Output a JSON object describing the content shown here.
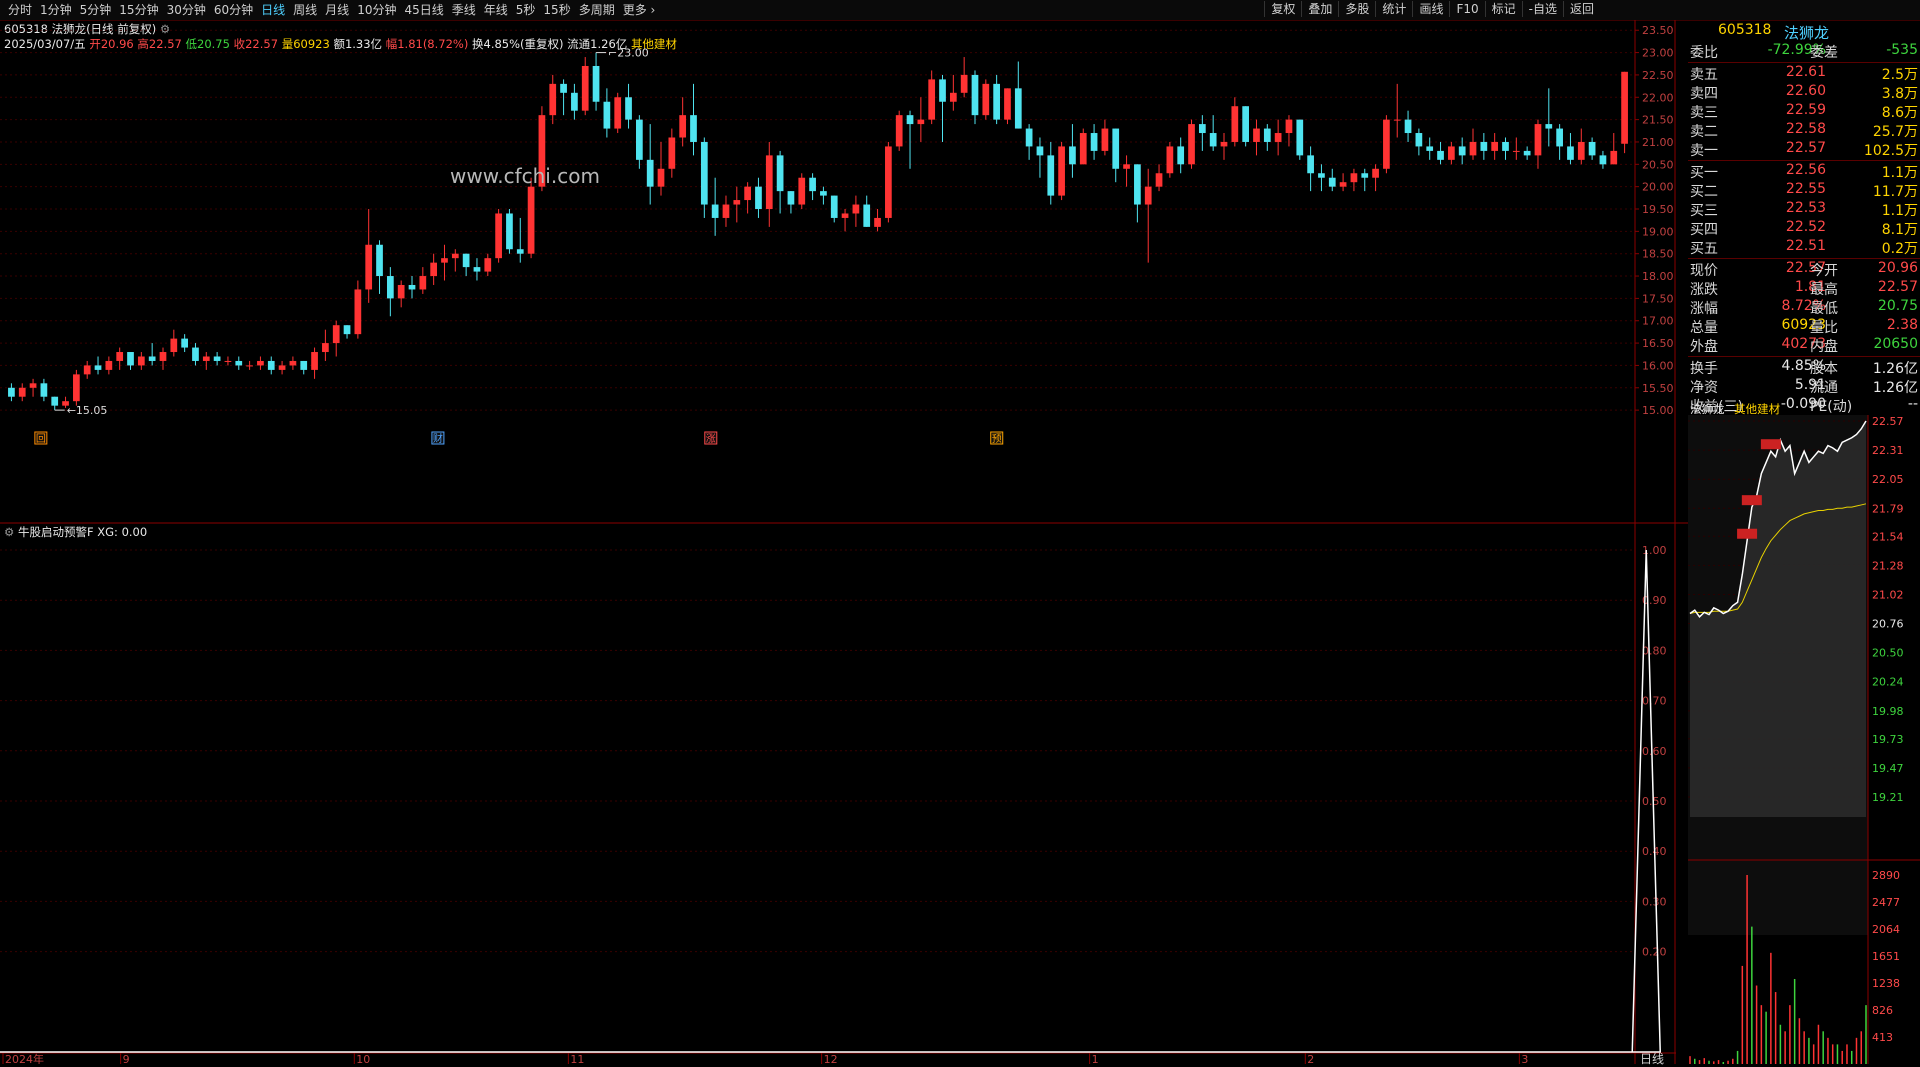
{
  "toolbar": {
    "tabs": [
      "分时",
      "1分钟",
      "5分钟",
      "15分钟",
      "30分钟",
      "60分钟",
      "日线",
      "周线",
      "月线",
      "10分钟",
      "45日线",
      "季线",
      "年线",
      "5秒",
      "15秒",
      "多周期",
      "更多"
    ],
    "active_tab": "日线",
    "tools": [
      "复权",
      "叠加",
      "多股",
      "统计",
      "画线",
      "F10",
      "标记",
      "-自选",
      "返回"
    ]
  },
  "stock": {
    "code": "605318",
    "name": "法狮龙",
    "period_desc": "(日线 前复权)",
    "date": "2025/03/07/五",
    "open_label": "开",
    "open": "20.96",
    "high_label": "高",
    "high": "22.57",
    "low_label": "低",
    "low": "20.75",
    "close_label": "收",
    "close": "22.57",
    "vol_label": "量",
    "vol": "60923",
    "amt_label": "额",
    "amt": "1.33亿",
    "chg_label": "幅",
    "chg": "1.81(8.72%)",
    "turn": "换4.85%(重复权)",
    "float": "流通1.26亿",
    "industry": "其他建材"
  },
  "watermark": "www.cfchi.com",
  "indicator": {
    "title": "牛股启动预警F",
    "value": "XG: 0.00"
  },
  "colors": {
    "up": "#ff3333",
    "down": "#4fe4f0",
    "axis": "#8b0000",
    "grid": "#3a0000",
    "indicator_line": "#ffffff"
  },
  "chart_data": [
    {
      "type": "candlestick",
      "title": "605318 法狮龙 日线",
      "ylim": [
        14.6,
        23.55
      ],
      "yticks": [
        "23.50",
        "23.00",
        "22.50",
        "22.00",
        "21.50",
        "21.00",
        "20.50",
        "20.00",
        "19.50",
        "19.00",
        "18.50",
        "18.00",
        "17.50",
        "17.00",
        "16.50",
        "16.00",
        "15.50",
        "15.00"
      ],
      "x_month_labels": [
        "2024年",
        "9",
        "10",
        "11",
        "12",
        "1",
        "2",
        "3"
      ],
      "annotations": {
        "max": "23.00",
        "min": "15.05",
        "markers": [
          "回",
          "财",
          "涨",
          "预"
        ]
      },
      "candles": [
        [
          15.5,
          15.6,
          15.2,
          15.3
        ],
        [
          15.3,
          15.6,
          15.2,
          15.5
        ],
        [
          15.5,
          15.7,
          15.3,
          15.6
        ],
        [
          15.6,
          15.7,
          15.2,
          15.3
        ],
        [
          15.3,
          15.3,
          15.0,
          15.1
        ],
        [
          15.1,
          15.3,
          15.05,
          15.2
        ],
        [
          15.2,
          15.9,
          15.1,
          15.8
        ],
        [
          15.8,
          16.1,
          15.7,
          16.0
        ],
        [
          16.0,
          16.2,
          15.8,
          15.9
        ],
        [
          15.9,
          16.2,
          15.8,
          16.1
        ],
        [
          16.1,
          16.4,
          15.9,
          16.3
        ],
        [
          16.3,
          16.2,
          15.9,
          16.0
        ],
        [
          16.0,
          16.3,
          15.9,
          16.2
        ],
        [
          16.2,
          16.5,
          16.0,
          16.1
        ],
        [
          16.1,
          16.4,
          15.9,
          16.3
        ],
        [
          16.3,
          16.8,
          16.2,
          16.6
        ],
        [
          16.6,
          16.7,
          16.3,
          16.4
        ],
        [
          16.4,
          16.5,
          16.0,
          16.1
        ],
        [
          16.1,
          16.3,
          15.9,
          16.2
        ],
        [
          16.2,
          16.3,
          16.0,
          16.1
        ],
        [
          16.1,
          16.2,
          16.0,
          16.1
        ],
        [
          16.1,
          16.2,
          15.9,
          16.0
        ],
        [
          16.0,
          16.1,
          15.9,
          16.0
        ],
        [
          16.0,
          16.2,
          15.9,
          16.1
        ],
        [
          16.1,
          16.2,
          15.8,
          15.9
        ],
        [
          15.9,
          16.1,
          15.8,
          16.0
        ],
        [
          16.0,
          16.2,
          15.9,
          16.1
        ],
        [
          16.1,
          16.1,
          15.8,
          15.9
        ],
        [
          15.9,
          16.4,
          15.7,
          16.3
        ],
        [
          16.3,
          16.8,
          16.1,
          16.5
        ],
        [
          16.5,
          17.0,
          16.2,
          16.9
        ],
        [
          16.9,
          16.9,
          16.6,
          16.7
        ],
        [
          16.7,
          17.9,
          16.6,
          17.7
        ],
        [
          17.7,
          19.5,
          17.4,
          18.7
        ],
        [
          18.7,
          18.8,
          17.6,
          18.0
        ],
        [
          18.0,
          18.2,
          17.1,
          17.5
        ],
        [
          17.5,
          17.9,
          17.3,
          17.8
        ],
        [
          17.8,
          18.0,
          17.5,
          17.7
        ],
        [
          17.7,
          18.2,
          17.6,
          18.0
        ],
        [
          18.0,
          18.5,
          17.8,
          18.3
        ],
        [
          18.3,
          18.7,
          17.9,
          18.4
        ],
        [
          18.4,
          18.6,
          18.1,
          18.5
        ],
        [
          18.5,
          18.5,
          18.0,
          18.2
        ],
        [
          18.2,
          18.4,
          17.9,
          18.1
        ],
        [
          18.1,
          18.5,
          18.0,
          18.4
        ],
        [
          18.4,
          19.5,
          18.3,
          19.4
        ],
        [
          19.4,
          19.5,
          18.5,
          18.6
        ],
        [
          18.6,
          19.3,
          18.3,
          18.5
        ],
        [
          18.5,
          20.2,
          18.4,
          20.0
        ],
        [
          20.0,
          21.8,
          19.9,
          21.6
        ],
        [
          21.6,
          22.5,
          21.4,
          22.3
        ],
        [
          22.3,
          22.4,
          21.6,
          22.1
        ],
        [
          22.1,
          22.3,
          21.5,
          21.7
        ],
        [
          21.7,
          22.9,
          21.6,
          22.7
        ],
        [
          22.7,
          23.0,
          21.7,
          21.9
        ],
        [
          21.9,
          22.2,
          21.1,
          21.3
        ],
        [
          21.3,
          22.1,
          21.2,
          22.0
        ],
        [
          22.0,
          22.3,
          21.3,
          21.5
        ],
        [
          21.5,
          21.6,
          20.4,
          20.6
        ],
        [
          20.6,
          21.4,
          19.6,
          20.0
        ],
        [
          20.0,
          21.0,
          19.8,
          20.4
        ],
        [
          20.4,
          21.3,
          20.2,
          21.1
        ],
        [
          21.1,
          22.0,
          20.9,
          21.6
        ],
        [
          21.6,
          22.3,
          20.7,
          21.0
        ],
        [
          21.0,
          21.1,
          19.3,
          19.6
        ],
        [
          19.6,
          20.2,
          18.9,
          19.3
        ],
        [
          19.3,
          19.8,
          19.1,
          19.6
        ],
        [
          19.6,
          20.0,
          19.2,
          19.7
        ],
        [
          19.7,
          20.1,
          19.4,
          20.0
        ],
        [
          20.0,
          20.2,
          19.3,
          19.5
        ],
        [
          19.5,
          21.0,
          19.1,
          20.7
        ],
        [
          20.7,
          20.8,
          19.4,
          19.9
        ],
        [
          19.9,
          19.9,
          19.4,
          19.6
        ],
        [
          19.6,
          20.3,
          19.5,
          20.2
        ],
        [
          20.2,
          20.3,
          19.7,
          19.9
        ],
        [
          19.9,
          20.0,
          19.6,
          19.8
        ],
        [
          19.8,
          19.8,
          19.2,
          19.3
        ],
        [
          19.3,
          19.5,
          19.0,
          19.4
        ],
        [
          19.4,
          19.8,
          19.1,
          19.6
        ],
        [
          19.6,
          19.8,
          19.1,
          19.1
        ],
        [
          19.1,
          19.5,
          19.0,
          19.3
        ],
        [
          19.3,
          21.0,
          19.2,
          20.9
        ],
        [
          20.9,
          21.7,
          20.8,
          21.6
        ],
        [
          21.6,
          21.7,
          20.4,
          21.4
        ],
        [
          21.4,
          22.0,
          21.0,
          21.5
        ],
        [
          21.5,
          22.6,
          21.4,
          22.4
        ],
        [
          22.4,
          22.5,
          21.0,
          21.9
        ],
        [
          21.9,
          22.5,
          21.7,
          22.1
        ],
        [
          22.1,
          22.9,
          22.0,
          22.5
        ],
        [
          22.5,
          22.6,
          21.4,
          21.6
        ],
        [
          21.6,
          22.4,
          21.5,
          22.3
        ],
        [
          22.3,
          22.5,
          21.4,
          21.5
        ],
        [
          21.5,
          22.2,
          21.4,
          22.2
        ],
        [
          22.2,
          22.8,
          21.3,
          21.3
        ],
        [
          21.3,
          21.4,
          20.6,
          20.9
        ],
        [
          20.9,
          21.1,
          20.2,
          20.7
        ],
        [
          20.7,
          21.0,
          19.6,
          19.8
        ],
        [
          19.8,
          21.0,
          19.7,
          20.9
        ],
        [
          20.9,
          21.4,
          20.2,
          20.5
        ],
        [
          20.5,
          21.3,
          20.5,
          21.2
        ],
        [
          21.2,
          21.4,
          20.6,
          20.8
        ],
        [
          20.8,
          21.5,
          20.7,
          21.3
        ],
        [
          21.3,
          21.3,
          20.1,
          20.4
        ],
        [
          20.4,
          20.7,
          20.0,
          20.5
        ],
        [
          20.5,
          20.5,
          19.2,
          19.6
        ],
        [
          19.6,
          20.4,
          18.3,
          20.0
        ],
        [
          20.0,
          20.5,
          19.9,
          20.3
        ],
        [
          20.3,
          21.0,
          20.2,
          20.9
        ],
        [
          20.9,
          21.1,
          20.3,
          20.5
        ],
        [
          20.5,
          21.5,
          20.4,
          21.4
        ],
        [
          21.4,
          21.6,
          20.8,
          21.2
        ],
        [
          21.2,
          21.6,
          20.8,
          20.9
        ],
        [
          20.9,
          21.2,
          20.6,
          21.0
        ],
        [
          21.0,
          22.0,
          20.9,
          21.8
        ],
        [
          21.8,
          21.8,
          20.9,
          21.0
        ],
        [
          21.0,
          21.5,
          20.7,
          21.3
        ],
        [
          21.3,
          21.4,
          20.8,
          21.0
        ],
        [
          21.0,
          21.5,
          20.7,
          21.2
        ],
        [
          21.2,
          21.6,
          20.9,
          21.5
        ],
        [
          21.5,
          21.5,
          20.6,
          20.7
        ],
        [
          20.7,
          20.9,
          19.9,
          20.3
        ],
        [
          20.3,
          20.5,
          19.9,
          20.2
        ],
        [
          20.2,
          20.4,
          19.9,
          20.0
        ],
        [
          20.0,
          20.3,
          19.9,
          20.1
        ],
        [
          20.1,
          20.4,
          19.9,
          20.3
        ],
        [
          20.3,
          20.4,
          19.9,
          20.2
        ],
        [
          20.2,
          20.5,
          19.9,
          20.4
        ],
        [
          20.4,
          21.6,
          20.3,
          21.5
        ],
        [
          21.5,
          22.3,
          21.1,
          21.5
        ],
        [
          21.5,
          21.7,
          21.0,
          21.2
        ],
        [
          21.2,
          21.3,
          20.7,
          20.9
        ],
        [
          20.9,
          21.1,
          20.6,
          20.8
        ],
        [
          20.8,
          21.0,
          20.5,
          20.6
        ],
        [
          20.6,
          21.0,
          20.5,
          20.9
        ],
        [
          20.9,
          21.1,
          20.5,
          20.7
        ],
        [
          20.7,
          21.3,
          20.6,
          21.0
        ],
        [
          21.0,
          21.2,
          20.6,
          20.8
        ],
        [
          20.8,
          21.2,
          20.6,
          21.0
        ],
        [
          21.0,
          21.1,
          20.6,
          20.8
        ],
        [
          20.8,
          21.1,
          20.6,
          20.8
        ],
        [
          20.8,
          20.9,
          20.6,
          20.7
        ],
        [
          20.7,
          21.5,
          20.4,
          21.4
        ],
        [
          21.4,
          22.2,
          20.9,
          21.3
        ],
        [
          21.3,
          21.4,
          20.6,
          20.9
        ],
        [
          20.9,
          21.2,
          20.5,
          20.6
        ],
        [
          20.6,
          21.3,
          20.5,
          21.0
        ],
        [
          21.0,
          21.1,
          20.6,
          20.7
        ],
        [
          20.7,
          20.8,
          20.4,
          20.5
        ],
        [
          20.5,
          21.2,
          20.5,
          20.8
        ],
        [
          20.96,
          22.57,
          20.75,
          22.57
        ]
      ]
    },
    {
      "type": "line",
      "title": "牛股启动预警F",
      "ylim": [
        0,
        1.0
      ],
      "yticks": [
        "1.00",
        "0.90",
        "0.80",
        "0.70",
        "0.60",
        "0.50",
        "0.40",
        "0.30",
        "0.20"
      ],
      "signal_index": 151,
      "values_desc": "XG signal series, 0 except peak 1 at signal_index"
    },
    {
      "type": "line",
      "title": "分时",
      "yticks": [
        "22.57",
        "22.31",
        "22.05",
        "21.79",
        "21.54",
        "21.28",
        "21.02",
        "20.76",
        "20.50",
        "20.24",
        "19.98",
        "19.73",
        "19.47",
        "19.21"
      ],
      "vol_ticks": [
        "2890",
        "2477",
        "2064",
        "1651",
        "1238",
        "826",
        "413"
      ],
      "price": [
        20.85,
        20.88,
        20.82,
        20.86,
        20.84,
        20.9,
        20.88,
        20.85,
        20.87,
        20.92,
        20.95,
        21.2,
        21.5,
        21.8,
        21.9,
        22.1,
        22.2,
        22.3,
        22.25,
        22.4,
        22.3,
        22.35,
        22.1,
        22.2,
        22.3,
        22.2,
        22.25,
        22.3,
        22.28,
        22.35,
        22.33,
        22.3,
        22.38,
        22.4,
        22.42,
        22.45,
        22.5,
        22.57
      ],
      "avg": [
        20.85,
        20.86,
        20.86,
        20.86,
        20.86,
        20.87,
        20.87,
        20.87,
        20.87,
        20.88,
        20.89,
        20.95,
        21.05,
        21.15,
        21.25,
        21.35,
        21.43,
        21.5,
        21.55,
        21.6,
        21.64,
        21.68,
        21.7,
        21.72,
        21.74,
        21.75,
        21.76,
        21.77,
        21.77,
        21.78,
        21.78,
        21.79,
        21.79,
        21.8,
        21.8,
        21.81,
        21.82,
        21.83
      ],
      "volume": [
        120,
        80,
        60,
        90,
        50,
        40,
        60,
        30,
        50,
        80,
        200,
        1500,
        2890,
        2100,
        1200,
        900,
        800,
        1700,
        1100,
        600,
        500,
        900,
        1300,
        700,
        500,
        400,
        300,
        600,
        500,
        400,
        300,
        300,
        200,
        300,
        200,
        400,
        500,
        900
      ]
    }
  ],
  "quote": {
    "header_code": "605318",
    "header_name": "法狮龙",
    "wb_label": "委比",
    "wb": "-72.99%",
    "wc_label": "委差",
    "wc": "-535",
    "asks": [
      {
        "label": "卖五",
        "price": "22.61",
        "vol": "2.5万"
      },
      {
        "label": "卖四",
        "price": "22.60",
        "vol": "3.8万"
      },
      {
        "label": "卖三",
        "price": "22.59",
        "vol": "8.6万"
      },
      {
        "label": "卖二",
        "price": "22.58",
        "vol": "25.7万"
      },
      {
        "label": "卖一",
        "price": "22.57",
        "vol": "102.5万"
      }
    ],
    "bids": [
      {
        "label": "买一",
        "price": "22.56",
        "vol": "1.1万"
      },
      {
        "label": "买二",
        "price": "22.55",
        "vol": "11.7万"
      },
      {
        "label": "买三",
        "price": "22.53",
        "vol": "1.1万"
      },
      {
        "label": "买四",
        "price": "22.52",
        "vol": "8.1万"
      },
      {
        "label": "买五",
        "price": "22.51",
        "vol": "0.2万"
      }
    ],
    "stats": [
      {
        "l1": "现价",
        "v1": "22.57",
        "l2": "今开",
        "v2": "20.96",
        "c1": "red",
        "c2": "red"
      },
      {
        "l1": "涨跌",
        "v1": "1.81",
        "l2": "最高",
        "v2": "22.57",
        "c1": "red",
        "c2": "red"
      },
      {
        "l1": "涨幅",
        "v1": "8.72%",
        "l2": "最低",
        "v2": "20.75",
        "c1": "red",
        "c2": "green"
      },
      {
        "l1": "总量",
        "v1": "60923",
        "l2": "量比",
        "v2": "2.38",
        "c1": "yellow",
        "c2": "red"
      },
      {
        "l1": "外盘",
        "v1": "40273",
        "l2": "内盘",
        "v2": "20650",
        "c1": "red",
        "c2": "green"
      }
    ],
    "stats2": [
      {
        "l1": "换手",
        "v1": "4.85%",
        "l2": "股本",
        "v2": "1.26亿"
      },
      {
        "l1": "净资",
        "v1": "5.91",
        "l2": "流通",
        "v2": "1.26亿"
      },
      {
        "l1": "收益(三)",
        "v1": "-0.090",
        "l2": "PE(动)",
        "v2": "--"
      }
    ],
    "mini_name": "法狮龙",
    "mini_industry": "其他建材",
    "bottom_tab": "日线"
  }
}
